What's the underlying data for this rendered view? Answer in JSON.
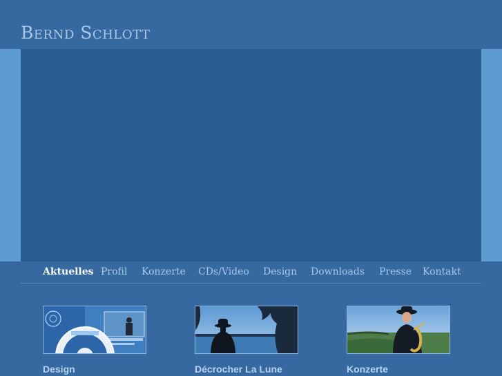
{
  "site": {
    "title": "Bernd Schlott"
  },
  "nav": {
    "items": [
      {
        "label": "Aktuelles",
        "active": true
      },
      {
        "label": "Profil",
        "active": false
      },
      {
        "label": "Konzerte",
        "active": false
      },
      {
        "label": "CDs/Video",
        "active": false
      },
      {
        "label": "Design",
        "active": false
      },
      {
        "label": "Downloads",
        "active": false
      },
      {
        "label": "Presse",
        "active": false
      },
      {
        "label": "Kontakt",
        "active": false
      }
    ]
  },
  "features": [
    {
      "title": "Design",
      "icon": "cd-design-image"
    },
    {
      "title": "Décrocher La Lune",
      "icon": "lake-silhouette-image"
    },
    {
      "title": "Konzerte",
      "icon": "saxophonist-image"
    }
  ],
  "colors": {
    "background": "#35699f",
    "hero": "#2a5e92",
    "side_bars": "#5c9cd0",
    "title": "#a9c9ea",
    "nav_text": "#a9c9ea",
    "nav_active": "#ffffff",
    "feature_title": "#b7d2ee"
  }
}
